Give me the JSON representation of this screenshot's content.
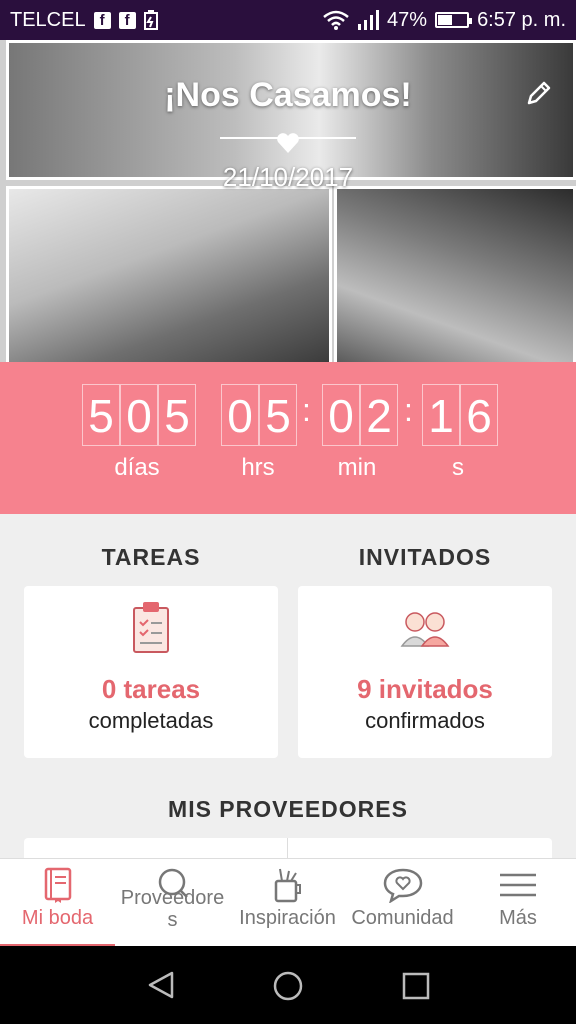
{
  "status_bar": {
    "carrier": "TELCEL",
    "notif_icons": [
      "facebook-icon",
      "facebook-icon",
      "battery-saver-icon"
    ],
    "battery": "47%",
    "battery_level": 0.47,
    "time": "6:57 p. m."
  },
  "hero": {
    "title": "¡Nos Casamos!",
    "date": "21/10/2017"
  },
  "countdown": {
    "days": [
      "5",
      "0",
      "5"
    ],
    "hours": [
      "0",
      "5"
    ],
    "minutes": [
      "0",
      "2"
    ],
    "seconds": [
      "1",
      "6"
    ],
    "labels": {
      "days": "días",
      "hours": "hrs",
      "minutes": "min",
      "seconds": "s"
    }
  },
  "tareas": {
    "title": "TAREAS",
    "count": "0 tareas",
    "sub": "completadas"
  },
  "invitados": {
    "title": "INVITADOS",
    "count": "9 invitados",
    "sub": "confirmados"
  },
  "proveedores": {
    "title": "MIS PROVEEDORES"
  },
  "nav": {
    "items": [
      {
        "label": "Mi boda",
        "icon": "book-icon"
      },
      {
        "label": "Proveedore\ns",
        "icon": "search-icon"
      },
      {
        "label": "Inspiración",
        "icon": "pencil-cup-icon"
      },
      {
        "label": "Comunidad",
        "icon": "chat-heart-icon"
      },
      {
        "label": "Más",
        "icon": "menu-icon"
      }
    ]
  },
  "colors": {
    "accent": "#e4676f",
    "countdown_bg": "#f6828e",
    "status_bg": "#2a0f3d"
  }
}
